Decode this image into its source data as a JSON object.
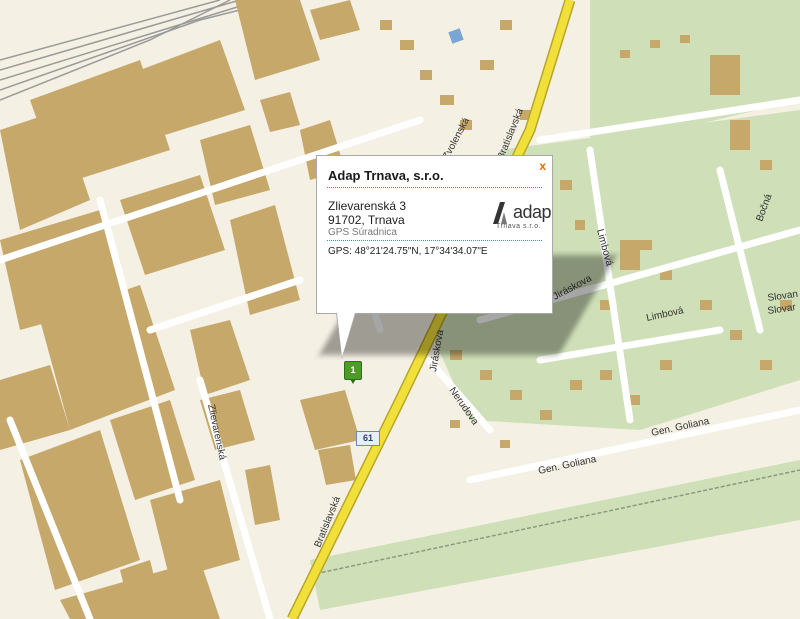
{
  "map": {
    "streets": [
      "Bratislavská",
      "Bratislavská",
      "Zlievarenská",
      "Jiráskova",
      "Jiráskova",
      "Nerudova",
      "Gen. Goliana",
      "Gen. Goliana",
      "Limbová",
      "Limbová",
      "Bočná",
      "Slovan",
      "Slovar",
      "Zvolenská"
    ],
    "road_number": "61",
    "marker_label": "1",
    "colors": {
      "background": "#f4f0e4",
      "building": "#c6a86a",
      "green": "#cfe0b8",
      "main_road": "#f2e03a"
    }
  },
  "popup": {
    "title": "Adap Trnava, s.r.o.",
    "close": "x",
    "address_line1": "Zlievarenská 3",
    "address_line2": "91702, Trnava",
    "gps_caption": "GPS Súradnica",
    "gps": "GPS: 48°21'24.75\"N, 17°34'34.07\"E",
    "logo_text": "adap",
    "logo_subtext": "Trnava s.r.o."
  }
}
